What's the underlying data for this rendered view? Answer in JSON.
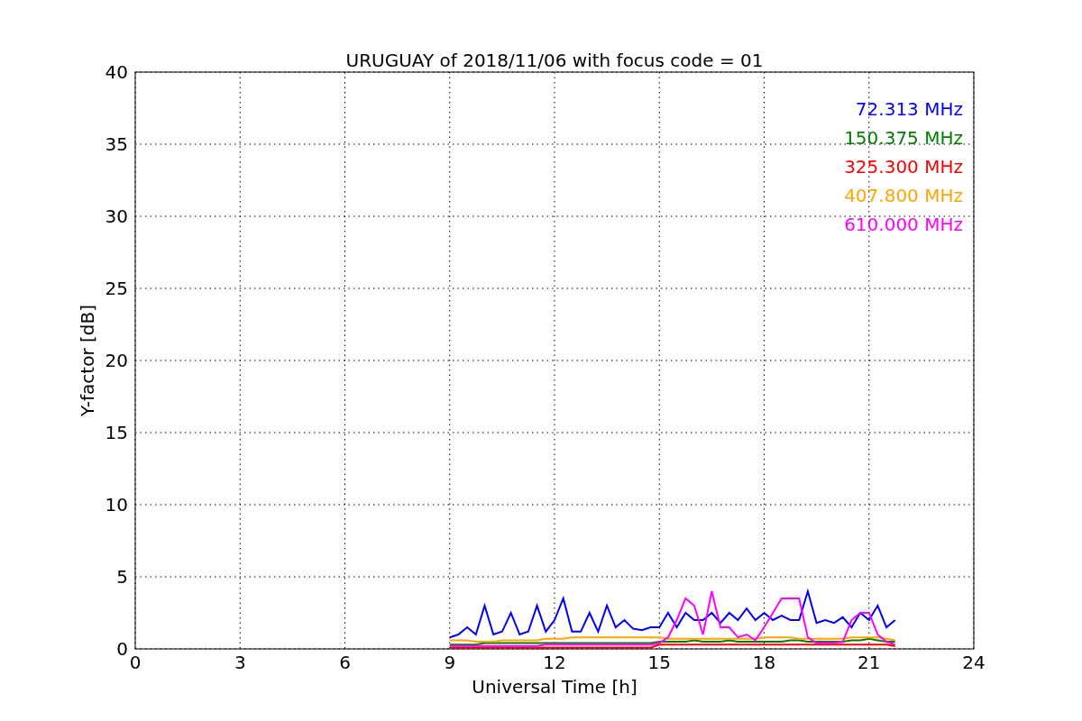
{
  "chart_data": {
    "type": "line",
    "title": "URUGUAY of 2018/11/06 with focus code = 01",
    "xlabel": "Universal Time [h]",
    "ylabel": "Y-factor [dB]",
    "grid": true,
    "xlim": [
      0,
      24
    ],
    "ylim": [
      0,
      40
    ],
    "xticks": [
      0,
      3,
      6,
      9,
      12,
      15,
      18,
      21,
      24
    ],
    "yticks": [
      0,
      5,
      10,
      15,
      20,
      25,
      30,
      35,
      40
    ],
    "x": [
      9,
      9.25,
      9.5,
      9.75,
      10,
      10.25,
      10.5,
      10.75,
      11,
      11.25,
      11.5,
      11.75,
      12,
      12.25,
      12.5,
      12.75,
      13,
      13.25,
      13.5,
      13.75,
      14,
      14.25,
      14.5,
      14.75,
      15,
      15.25,
      15.5,
      15.75,
      16,
      16.25,
      16.5,
      16.75,
      17,
      17.25,
      17.5,
      17.75,
      18,
      18.25,
      18.5,
      18.75,
      19,
      19.25,
      19.5,
      19.75,
      20,
      20.25,
      20.5,
      20.75,
      21,
      21.25,
      21.5,
      21.75
    ],
    "series": [
      {
        "name": "72.313 MHz",
        "color": "#0000ff",
        "values": [
          0.8,
          1.0,
          1.5,
          1.0,
          3.0,
          1.0,
          1.2,
          2.5,
          1.0,
          1.2,
          3.0,
          1.2,
          2.0,
          3.5,
          1.2,
          1.2,
          2.5,
          1.2,
          3.0,
          1.5,
          2.0,
          1.4,
          1.3,
          1.5,
          1.5,
          2.5,
          1.5,
          2.5,
          2.0,
          2.0,
          2.5,
          1.8,
          2.5,
          2.0,
          2.8,
          2.0,
          2.5,
          2.0,
          2.3,
          2.0,
          2.0,
          4.0,
          1.8,
          2.0,
          1.8,
          2.2,
          1.5,
          2.5,
          2.0,
          3.0,
          1.5,
          2.0
        ]
      },
      {
        "name": "150.375 MHz",
        "color": "#008000",
        "values": [
          0.3,
          0.3,
          0.3,
          0.3,
          0.4,
          0.4,
          0.4,
          0.4,
          0.4,
          0.4,
          0.4,
          0.4,
          0.4,
          0.4,
          0.4,
          0.4,
          0.4,
          0.4,
          0.4,
          0.4,
          0.4,
          0.4,
          0.4,
          0.4,
          0.5,
          0.5,
          0.5,
          0.5,
          0.6,
          0.5,
          0.5,
          0.5,
          0.6,
          0.5,
          0.5,
          0.5,
          0.5,
          0.5,
          0.5,
          0.6,
          0.6,
          0.5,
          0.5,
          0.5,
          0.5,
          0.5,
          0.6,
          0.6,
          0.7,
          0.6,
          0.5,
          0.5
        ]
      },
      {
        "name": "325.300 MHz",
        "color": "#ff0000",
        "values": [
          0.1,
          0.1,
          0.1,
          0.1,
          0.1,
          0.1,
          0.1,
          0.1,
          0.1,
          0.1,
          0.1,
          0.1,
          0.1,
          0.1,
          0.1,
          0.1,
          0.1,
          0.1,
          0.1,
          0.1,
          0.1,
          0.1,
          0.1,
          0.1,
          0.3,
          0.3,
          0.3,
          0.3,
          0.3,
          0.3,
          0.3,
          0.3,
          0.3,
          0.3,
          0.3,
          0.3,
          0.3,
          0.3,
          0.3,
          0.3,
          0.3,
          0.3,
          0.3,
          0.3,
          0.3,
          0.3,
          0.3,
          0.3,
          0.3,
          0.3,
          0.3,
          0.2
        ]
      },
      {
        "name": "407.800 MHz",
        "color": "#ffa500",
        "values": [
          0.6,
          0.6,
          0.6,
          0.5,
          0.5,
          0.5,
          0.6,
          0.6,
          0.6,
          0.6,
          0.6,
          0.7,
          0.7,
          0.7,
          0.8,
          0.8,
          0.8,
          0.8,
          0.8,
          0.8,
          0.8,
          0.8,
          0.8,
          0.8,
          0.8,
          0.7,
          0.7,
          0.7,
          0.7,
          0.7,
          0.7,
          0.7,
          0.7,
          0.7,
          0.7,
          0.7,
          0.8,
          0.8,
          0.8,
          0.8,
          0.7,
          0.7,
          0.7,
          0.7,
          0.7,
          0.7,
          0.8,
          0.8,
          0.8,
          0.8,
          0.7,
          0.6
        ]
      },
      {
        "name": "610.000 MHz",
        "color": "#ff00ff",
        "values": [
          0.2,
          0.2,
          0.2,
          0.2,
          0.2,
          0.2,
          0.2,
          0.2,
          0.2,
          0.2,
          0.2,
          0.3,
          0.3,
          0.3,
          0.3,
          0.3,
          0.3,
          0.3,
          0.3,
          0.3,
          0.3,
          0.3,
          0.3,
          0.3,
          0.4,
          0.8,
          2.0,
          3.5,
          3.0,
          1.0,
          4.0,
          1.5,
          1.5,
          0.8,
          1.0,
          0.6,
          1.5,
          2.5,
          3.5,
          3.5,
          3.5,
          0.8,
          0.4,
          0.4,
          0.4,
          0.5,
          2.0,
          2.5,
          2.5,
          1.0,
          0.5,
          0.3
        ]
      }
    ]
  }
}
